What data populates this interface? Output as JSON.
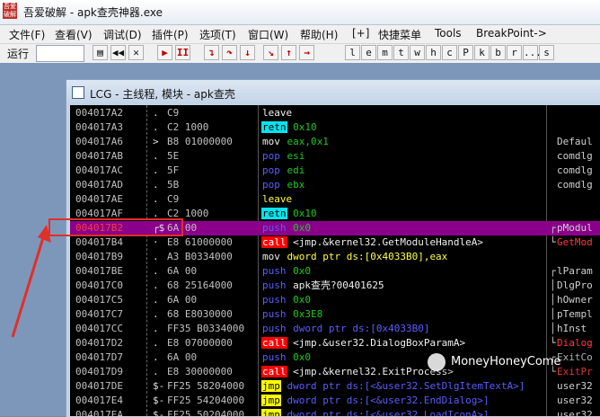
{
  "window": {
    "title": "吾爱破解 - apk查壳神器.exe",
    "logo_text": "吾爱\n破解"
  },
  "menu": [
    {
      "label": "文件(F)"
    },
    {
      "label": "查看(V)"
    },
    {
      "label": "调试(D)"
    },
    {
      "label": "插件(P)"
    },
    {
      "label": "选项(T)"
    },
    {
      "label": "窗口(W)"
    },
    {
      "label": "帮助(H)"
    },
    {
      "label": "[+]"
    },
    {
      "label": "快捷菜单"
    },
    {
      "label": "Tools"
    },
    {
      "label": "BreakPoint->"
    }
  ],
  "toolbar": {
    "run_label": "运行",
    "buttons": [
      {
        "name": "open-icon",
        "glyph": "▤"
      },
      {
        "name": "rewind-icon",
        "glyph": "◀◀"
      },
      {
        "name": "close-icon",
        "glyph": "✕"
      },
      {
        "name": "run-icon",
        "glyph": "▶"
      },
      {
        "name": "pause-icon",
        "glyph": "II"
      },
      {
        "name": "step-into-icon",
        "glyph": "↴"
      },
      {
        "name": "step-over-icon",
        "glyph": "↷"
      },
      {
        "name": "trace-into-icon",
        "glyph": "↓"
      },
      {
        "name": "trace-over-icon",
        "glyph": "↘"
      },
      {
        "name": "execute-till-return-icon",
        "glyph": "↑"
      },
      {
        "name": "goto-icon",
        "glyph": "→"
      }
    ],
    "letters": [
      "l",
      "e",
      "m",
      "t",
      "w",
      "h",
      "c",
      "P",
      "k",
      "b",
      "r",
      "...",
      "s"
    ]
  },
  "cpu_window": {
    "title": "LCG - 主线程, 模块 - apk查壳"
  },
  "rows": [
    {
      "addr": "004017A2",
      "mark": ".",
      "hex": "C9",
      "mn": "leave",
      "mnStyle": "white",
      "ops": []
    },
    {
      "addr": "004017A3",
      "mark": ".",
      "hex": "C2 1000",
      "mn": "retn",
      "mnStyle": "cyan",
      "ops": [
        {
          "t": " 0x10",
          "c": "g"
        }
      ]
    },
    {
      "addr": "004017A6",
      "mark": ">",
      "hex": "B8 01000000",
      "mn": "mov",
      "mnStyle": "white",
      "ops": [
        {
          "t": " eax,0x1",
          "c": "g"
        }
      ],
      "cmt": "Defaul"
    },
    {
      "addr": "004017AB",
      "mark": ".",
      "hex": "5E",
      "mn": "pop",
      "mnStyle": "blue",
      "ops": [
        {
          "t": " esi",
          "c": "g"
        }
      ],
      "cmt": "comdlg"
    },
    {
      "addr": "004017AC",
      "mark": ".",
      "hex": "5F",
      "mn": "pop",
      "mnStyle": "blue",
      "ops": [
        {
          "t": " edi",
          "c": "g"
        }
      ],
      "cmt": "comdlg"
    },
    {
      "addr": "004017AD",
      "mark": ".",
      "hex": "5B",
      "mn": "pop",
      "mnStyle": "blue",
      "ops": [
        {
          "t": " ebx",
          "c": "g"
        }
      ],
      "cmt": "comdlg"
    },
    {
      "addr": "004017AE",
      "mark": ".",
      "hex": "C9",
      "mn": "leave",
      "mnStyle": "yellowtx",
      "ops": []
    },
    {
      "addr": "004017AF",
      "mark": ".",
      "hex": "C2 1000",
      "mn": "retn",
      "mnStyle": "cyan",
      "ops": [
        {
          "t": " 0x10",
          "c": "g"
        }
      ]
    },
    {
      "addr": "004017B2",
      "mark": "┌$",
      "hex": "6A 00",
      "mn": "push",
      "mnStyle": "blue",
      "ops": [
        {
          "t": " 0x0",
          "c": "g"
        }
      ],
      "cmt": "pModul",
      "sel": true,
      "bm": "┌"
    },
    {
      "addr": "004017B4",
      "mark": "·",
      "hex": "E8 61000000",
      "mn": "call",
      "mnStyle": "redbg",
      "ops": [
        {
          "t": " <jmp.&kernel32.GetModuleHandleA>",
          "c": "w"
        }
      ],
      "cmt": "GetMod",
      "cmtRed": true,
      "bm": "└"
    },
    {
      "addr": "004017B9",
      "mark": ".",
      "hex": "A3 B0334000",
      "mn": "mov",
      "mnStyle": "white",
      "ops": [
        {
          "t": " dword ptr ds:[0x4033B0],eax",
          "c": "y"
        }
      ]
    },
    {
      "addr": "004017BE",
      "mark": ".",
      "hex": "6A 00",
      "mn": "push",
      "mnStyle": "blue",
      "ops": [
        {
          "t": " 0x0",
          "c": "g"
        }
      ],
      "cmt": "lParam",
      "bm": "┌"
    },
    {
      "addr": "004017C0",
      "mark": ".",
      "hex": "68 25164000",
      "mn": "push",
      "mnStyle": "blue",
      "ops": [
        {
          "t": " apk查壳?00401625",
          "c": "w"
        }
      ],
      "cmt": "DlgPro",
      "bm": "│"
    },
    {
      "addr": "004017C5",
      "mark": ".",
      "hex": "6A 00",
      "mn": "push",
      "mnStyle": "blue",
      "ops": [
        {
          "t": " 0x0",
          "c": "g"
        }
      ],
      "cmt": "hOwner",
      "bm": "│"
    },
    {
      "addr": "004017C7",
      "mark": ".",
      "hex": "68 E8030000",
      "mn": "push",
      "mnStyle": "blue",
      "ops": [
        {
          "t": " 0x3E8",
          "c": "g"
        }
      ],
      "cmt": "pTempl",
      "bm": "│"
    },
    {
      "addr": "004017CC",
      "mark": ".",
      "hex": "FF35 B0334000",
      "mn": "push",
      "mnStyle": "blue",
      "ops": [
        {
          "t": " dword ptr ds:[0x4033B0]",
          "c": "b"
        }
      ],
      "cmt": "hInst",
      "bm": "│"
    },
    {
      "addr": "004017D2",
      "mark": ".",
      "hex": "E8 07000000",
      "mn": "call",
      "mnStyle": "redbg",
      "ops": [
        {
          "t": " <jmp.&user32.DialogBoxParamA>",
          "c": "w"
        }
      ],
      "cmt": "Dialog",
      "cmtRed": true,
      "bm": "└"
    },
    {
      "addr": "004017D7",
      "mark": ".",
      "hex": "6A 00",
      "mn": "push",
      "mnStyle": "blue",
      "ops": [
        {
          "t": " 0x0",
          "c": "g"
        }
      ],
      "cmt": "ExitCo",
      "bm": "┌"
    },
    {
      "addr": "004017D9",
      "mark": ".",
      "hex": "E8 30000000",
      "mn": "call",
      "mnStyle": "redbg",
      "ops": [
        {
          "t": " <jmp.&kernel32.ExitProcess>",
          "c": "w"
        }
      ],
      "cmt": "ExitPr",
      "cmtRed": true,
      "bm": "└"
    },
    {
      "addr": "004017DE",
      "mark": "$-",
      "hex": "FF25 58204000",
      "mn": "jmp",
      "mnStyle": "yellow",
      "ops": [
        {
          "t": " dword ptr ds:[<&user32.SetDlgItemTextA>]",
          "c": "b"
        }
      ],
      "cmt": "user32"
    },
    {
      "addr": "004017E4",
      "mark": "$-",
      "hex": "FF25 54204000",
      "mn": "jmp",
      "mnStyle": "yellow",
      "ops": [
        {
          "t": " dword ptr ds:[<&user32.EndDialog>]",
          "c": "b"
        }
      ],
      "cmt": "user32"
    },
    {
      "addr": "004017EA",
      "mark": "$-",
      "hex": "FF25 50204000",
      "mn": "jmp",
      "mnStyle": "yellow",
      "ops": [
        {
          "t": " dword ptr ds:[<&user32.LoadIconA>]",
          "c": "b"
        }
      ],
      "cmt": "user32"
    }
  ],
  "watermark": {
    "text": "MoneyHoneyCome"
  }
}
